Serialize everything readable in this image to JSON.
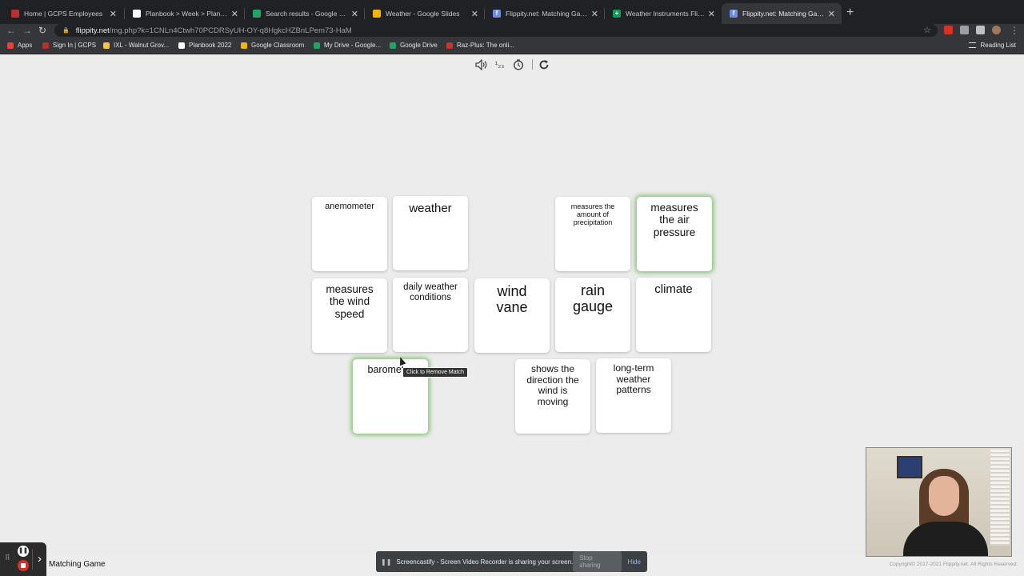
{
  "browser": {
    "tabs": [
      {
        "title": "Home | GCPS Employees",
        "favicon_color": "#b8312f"
      },
      {
        "title": "Planbook > Week > PlanbookEdu",
        "favicon_color": "#ffffff"
      },
      {
        "title": "Search results - Google Drive",
        "favicon_color": "#1fa463"
      },
      {
        "title": "Weather - Google Slides",
        "favicon_color": "#f4b400"
      },
      {
        "title": "Flippity.net: Matching Game Instr",
        "favicon_color": "#6b8ee8"
      },
      {
        "title": "Weather Instruments Flippity",
        "favicon_color": "#0f9d58"
      },
      {
        "title": "Flippity.net: Matching Game",
        "favicon_color": "#6b8ee8",
        "active": true
      }
    ],
    "url_host": "flippity.net",
    "url_path": "/mg.php?k=1CNLn4Ctwh70PCDRSyUH-OY-q8HgkcHZBnLPem73-HaM",
    "bookmarks": [
      {
        "label": "Apps",
        "color": "#e94235"
      },
      {
        "label": "Sign In | GCPS",
        "color": "#b8312f"
      },
      {
        "label": "IXL - Walnut Grov...",
        "color": "#f6c343"
      },
      {
        "label": "Planbook 2022",
        "color": "#ffffff"
      },
      {
        "label": "Google Classroom",
        "color": "#f4b400"
      },
      {
        "label": "My Drive - Google...",
        "color": "#1fa463"
      },
      {
        "label": "Google Drive",
        "color": "#1fa463"
      },
      {
        "label": "Raz-Plus: The onli...",
        "color": "#c0392b"
      }
    ],
    "reading_list": "Reading List"
  },
  "game": {
    "controls": {
      "sound_icon": "speaker-icon",
      "numbers": "¹₂₃",
      "timer_icon": "timer-icon",
      "reset_icon": "reset-icon"
    },
    "cards": [
      {
        "text": "anemometer",
        "matched": false
      },
      {
        "text": "weather",
        "matched": false
      },
      {
        "text": "measures the amount of precipitation",
        "matched": false
      },
      {
        "text": "measures the air pressure",
        "matched": true
      },
      {
        "text": "measures the wind speed",
        "matched": false
      },
      {
        "text": "daily weather conditions",
        "matched": false
      },
      {
        "text": "wind vane",
        "matched": false
      },
      {
        "text": "rain gauge",
        "matched": false
      },
      {
        "text": "climate",
        "matched": false
      },
      {
        "text": "barometer",
        "matched": true
      },
      {
        "text": "shows the direction the wind is moving",
        "matched": false
      },
      {
        "text": "long-term weather patterns",
        "matched": false
      }
    ],
    "tooltip": "Click to Remove Match",
    "copyright": "Copyright© 2017-2021 Flippity.net. All Rights Reserved."
  },
  "bottom": {
    "page_title": "Matching Game",
    "share_message": "Screencastify - Screen Video Recorder is sharing your screen.",
    "stop_sharing": "Stop sharing",
    "hide": "Hide"
  },
  "colors": {
    "match_glow": "#60b24a",
    "tab_bar": "#202124",
    "page_bg": "#ececec"
  }
}
